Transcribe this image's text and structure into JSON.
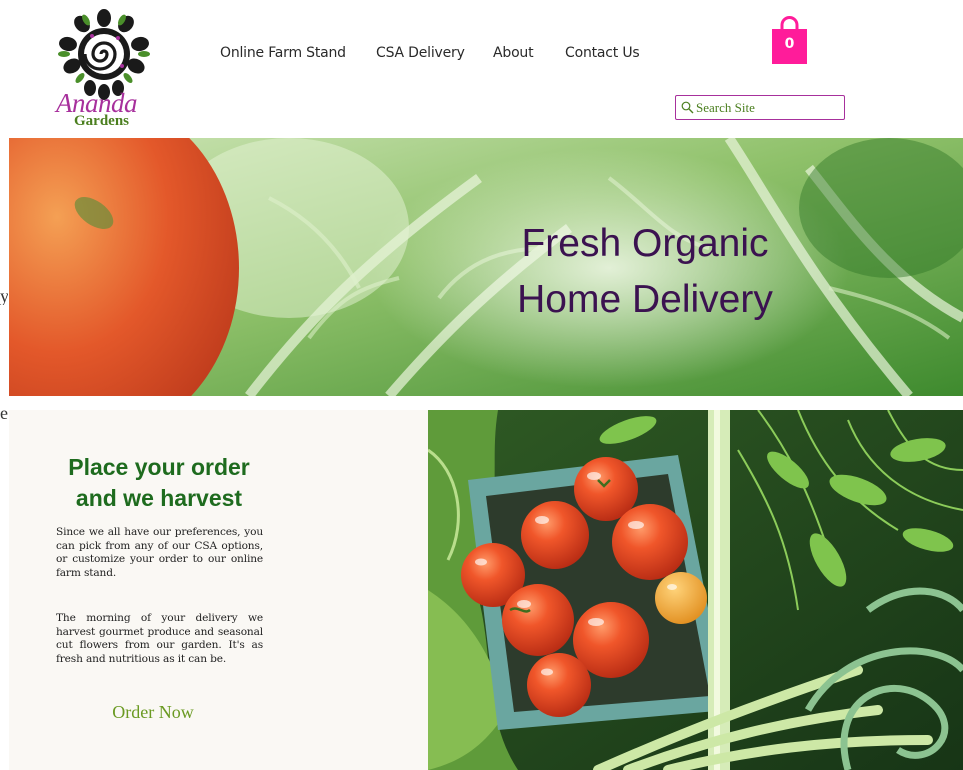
{
  "brand": {
    "name_line1": "Ananda",
    "name_line2": "Gardens",
    "logo_icon": "sunflower-logo-icon"
  },
  "nav": {
    "items": [
      {
        "label": "Online Farm Stand"
      },
      {
        "label": "CSA Delivery"
      },
      {
        "label": "About"
      },
      {
        "label": "Contact Us"
      }
    ]
  },
  "cart": {
    "count": "0",
    "icon": "shopping-bag-icon",
    "color": "#ff1c9a"
  },
  "search": {
    "placeholder": "Search Site",
    "value": "",
    "icon": "search-icon"
  },
  "edge_fragments": [
    "y",
    "e"
  ],
  "hero": {
    "title_line1": "Fresh Organic",
    "title_line2": "Home Delivery",
    "title_color": "#3b1250"
  },
  "order": {
    "heading_line1": "Place your order",
    "heading_line2": "and we harvest",
    "paragraph1": "Since we all have our preferences, you can pick from any of our CSA options, or customize your order to our online farm stand.",
    "paragraph2": "The morning of your delivery we harvest gourmet produce and seasonal cut flowers from our garden. It's as fresh and nutritious as it can be.",
    "cta_label": "Order Now",
    "accent_color": "#6a9a22"
  }
}
